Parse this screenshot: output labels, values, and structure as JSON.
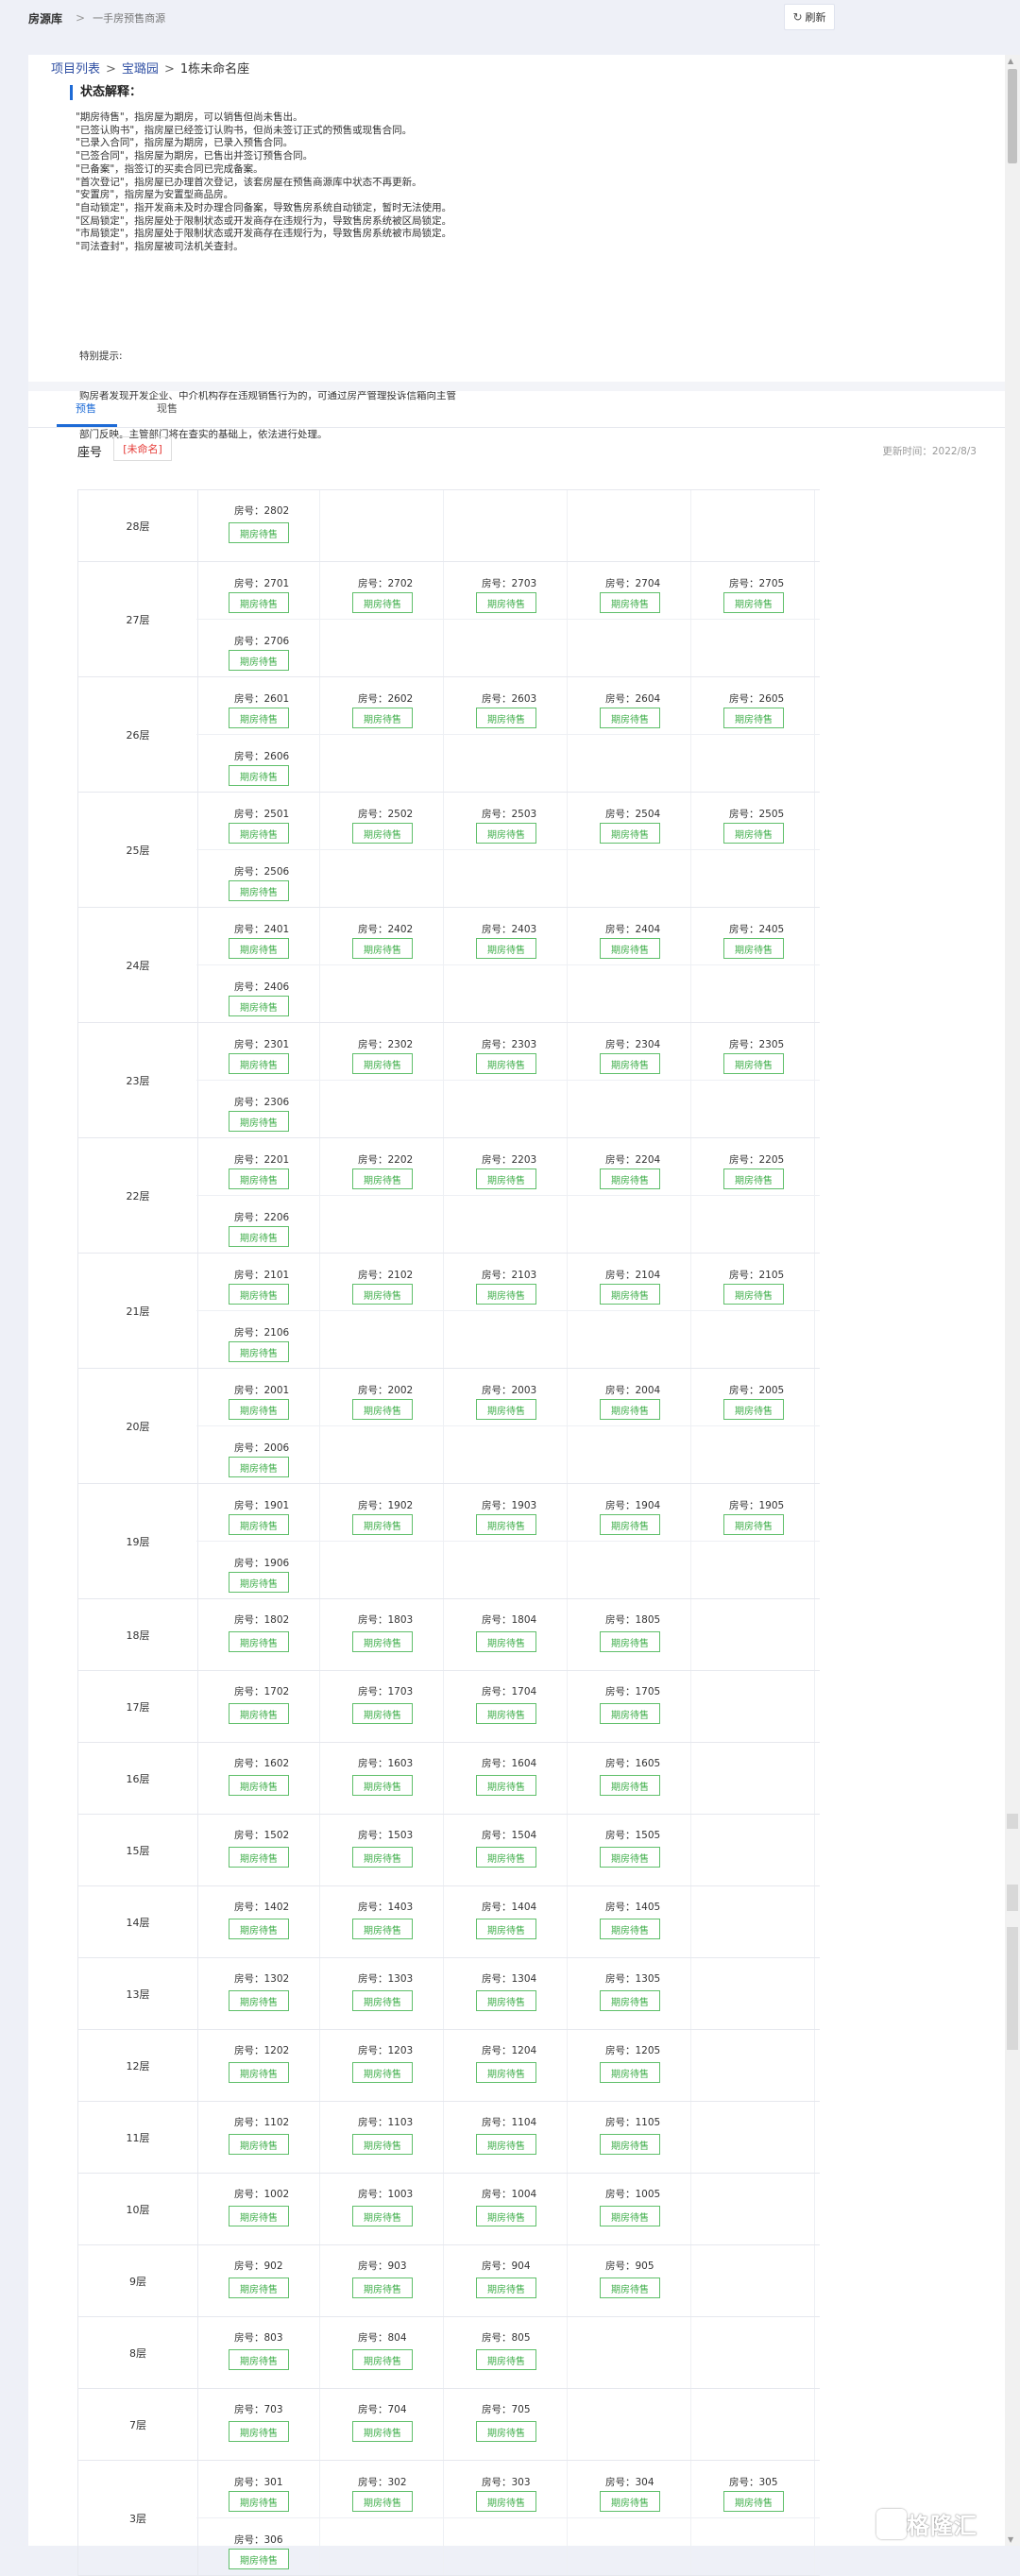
{
  "topbar": {
    "brand": "房源库",
    "separator": ">",
    "crumb": "一手房预售商源",
    "refresh_label": "刷新"
  },
  "breadcrumb": {
    "items": [
      "项目列表",
      "宝璐园",
      "1栋未命名座"
    ],
    "sep": ">"
  },
  "status": {
    "title": "状态解释：",
    "lines": [
      "\"期房待售\"，指房屋为期房，可以销售但尚未售出。",
      "\"已签认购书\"，指房屋已经签订认购书，但尚未签订正式的预售或现售合同。",
      "\"已录入合同\"，指房屋为期房，已录入预售合同。",
      "\"已签合同\"，指房屋为期房，已售出并签订预售合同。",
      "\"已备案\"，指签订的买卖合同已完成备案。",
      "\"首次登记\"，指房屋已办理首次登记，该套房屋在预售商源库中状态不再更新。",
      "\"安置房\"，指房屋为安置型商品房。",
      "\"自动锁定\"，指开发商未及时办理合同备案，导致售房系统自动锁定，暂时无法使用。",
      "\"区局锁定\"，指房屋处于限制状态或开发商存在违规行为，导致售房系统被区局锁定。",
      "\"市局锁定\"，指房屋处于限制状态或开发商存在违规行为，导致售房系统被市局锁定。",
      "\"司法查封\"，指房屋被司法机关查封。"
    ]
  },
  "notice": {
    "title": "特别提示:",
    "lines": [
      "购房者发现开发企业、中介机构存在违规销售行为的，可通过房产管理投诉信箱向主管",
      "部门反映。主管部门将在查实的基础上，依法进行处理。"
    ]
  },
  "tabs": [
    "预售",
    "现售"
  ],
  "seat": {
    "label": "座号",
    "tag": "[未命名]",
    "update_time": "更新时间：2022/8/3"
  },
  "unit_prefix": "房号：",
  "status_label": "期房待售",
  "floors": [
    {
      "name": "28层",
      "rows": [
        [
          "2802"
        ]
      ]
    },
    {
      "name": "27层",
      "rows": [
        [
          "2701",
          "2702",
          "2703",
          "2704",
          "2705"
        ],
        [
          "2706"
        ]
      ]
    },
    {
      "name": "26层",
      "rows": [
        [
          "2601",
          "2602",
          "2603",
          "2604",
          "2605"
        ],
        [
          "2606"
        ]
      ]
    },
    {
      "name": "25层",
      "rows": [
        [
          "2501",
          "2502",
          "2503",
          "2504",
          "2505"
        ],
        [
          "2506"
        ]
      ]
    },
    {
      "name": "24层",
      "rows": [
        [
          "2401",
          "2402",
          "2403",
          "2404",
          "2405"
        ],
        [
          "2406"
        ]
      ]
    },
    {
      "name": "23层",
      "rows": [
        [
          "2301",
          "2302",
          "2303",
          "2304",
          "2305"
        ],
        [
          "2306"
        ]
      ]
    },
    {
      "name": "22层",
      "rows": [
        [
          "2201",
          "2202",
          "2203",
          "2204",
          "2205"
        ],
        [
          "2206"
        ]
      ]
    },
    {
      "name": "21层",
      "rows": [
        [
          "2101",
          "2102",
          "2103",
          "2104",
          "2105"
        ],
        [
          "2106"
        ]
      ]
    },
    {
      "name": "20层",
      "rows": [
        [
          "2001",
          "2002",
          "2003",
          "2004",
          "2005"
        ],
        [
          "2006"
        ]
      ]
    },
    {
      "name": "19层",
      "rows": [
        [
          "1901",
          "1902",
          "1903",
          "1904",
          "1905"
        ],
        [
          "1906"
        ]
      ]
    },
    {
      "name": "18层",
      "rows": [
        [
          "1802",
          "1803",
          "1804",
          "1805"
        ]
      ]
    },
    {
      "name": "17层",
      "rows": [
        [
          "1702",
          "1703",
          "1704",
          "1705"
        ]
      ]
    },
    {
      "name": "16层",
      "rows": [
        [
          "1602",
          "1603",
          "1604",
          "1605"
        ]
      ]
    },
    {
      "name": "15层",
      "rows": [
        [
          "1502",
          "1503",
          "1504",
          "1505"
        ]
      ]
    },
    {
      "name": "14层",
      "rows": [
        [
          "1402",
          "1403",
          "1404",
          "1405"
        ]
      ]
    },
    {
      "name": "13层",
      "rows": [
        [
          "1302",
          "1303",
          "1304",
          "1305"
        ]
      ]
    },
    {
      "name": "12层",
      "rows": [
        [
          "1202",
          "1203",
          "1204",
          "1205"
        ]
      ]
    },
    {
      "name": "11层",
      "rows": [
        [
          "1102",
          "1103",
          "1104",
          "1105"
        ]
      ]
    },
    {
      "name": "10层",
      "rows": [
        [
          "1002",
          "1003",
          "1004",
          "1005"
        ]
      ]
    },
    {
      "name": "9层",
      "rows": [
        [
          "902",
          "903",
          "904",
          "905"
        ]
      ]
    },
    {
      "name": "8层",
      "rows": [
        [
          "803",
          "804",
          "805"
        ]
      ]
    },
    {
      "name": "7层",
      "rows": [
        [
          "703",
          "704",
          "705"
        ]
      ]
    },
    {
      "name": "3层",
      "rows": [
        [
          "301",
          "302",
          "303",
          "304",
          "305"
        ],
        [
          "306"
        ]
      ]
    }
  ],
  "watermark": "格隆汇"
}
